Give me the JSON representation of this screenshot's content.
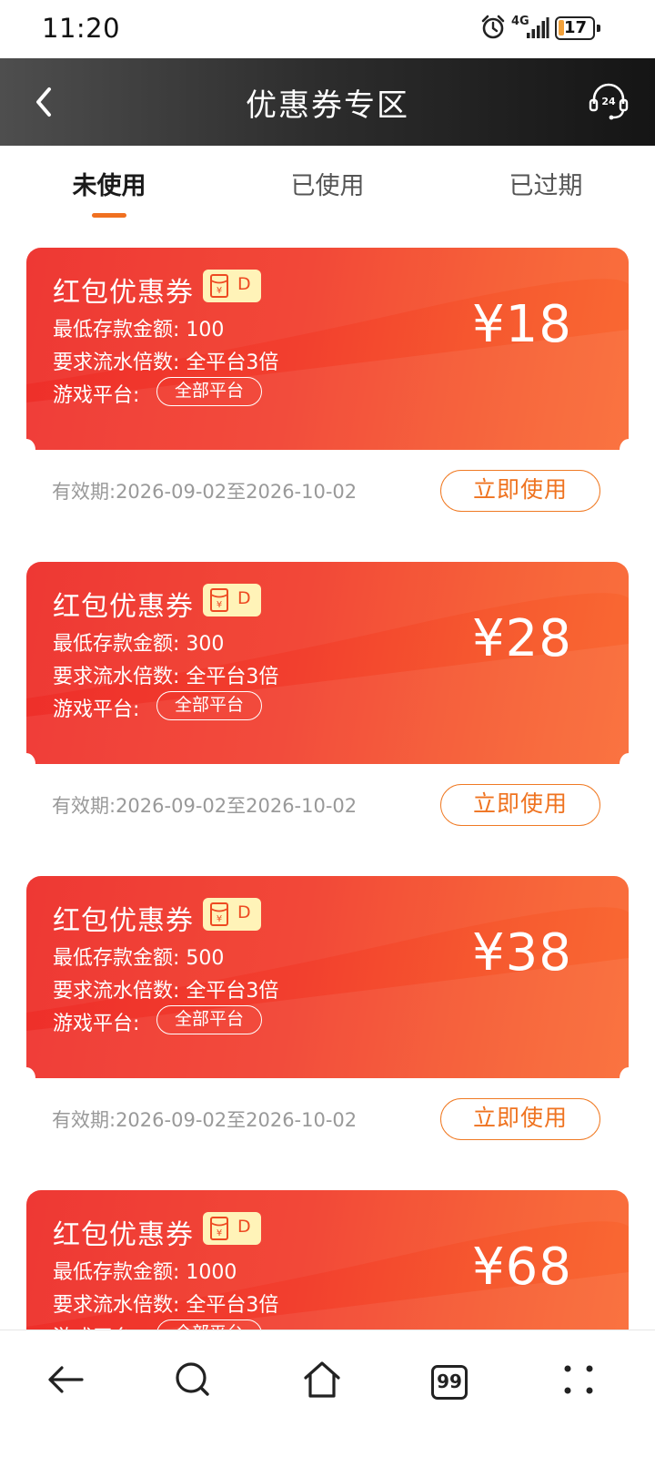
{
  "status_bar": {
    "time": "11:20",
    "network": "4G",
    "battery": "17",
    "battery_level": 0.17,
    "icons": [
      "alarm-icon",
      "signal-icon",
      "battery-icon"
    ]
  },
  "header": {
    "title": "优惠券专区",
    "back_icon": "chevron-left-icon",
    "support_icon": "support-24h-icon"
  },
  "tabs": [
    {
      "label": "未使用",
      "active": true
    },
    {
      "label": "已使用",
      "active": false
    },
    {
      "label": "已过期",
      "active": false
    }
  ],
  "colors": {
    "accent": "#F07020",
    "card_start": "#EE2E2A",
    "card_end": "#FA6A33",
    "badge_bg": "#FFF3B8"
  },
  "coupons": [
    {
      "name": "红包优惠券",
      "badge_letter": "D",
      "min_deposit": "最低存款金额: 100",
      "turnover": "要求流水倍数: 全平台3倍",
      "platform_label": "游戏平台:",
      "platform_tag": "全部平台",
      "amount": "¥18",
      "validity": "有效期:2026-09-02至2026-10-02",
      "button": "立即使用"
    },
    {
      "name": "红包优惠券",
      "badge_letter": "D",
      "min_deposit": "最低存款金额: 300",
      "turnover": "要求流水倍数: 全平台3倍",
      "platform_label": "游戏平台:",
      "platform_tag": "全部平台",
      "amount": "¥28",
      "validity": "有效期:2026-09-02至2026-10-02",
      "button": "立即使用"
    },
    {
      "name": "红包优惠券",
      "badge_letter": "D",
      "min_deposit": "最低存款金额: 500",
      "turnover": "要求流水倍数: 全平台3倍",
      "platform_label": "游戏平台:",
      "platform_tag": "全部平台",
      "amount": "¥38",
      "validity": "有效期:2026-09-02至2026-10-02",
      "button": "立即使用"
    },
    {
      "name": "红包优惠券",
      "badge_letter": "D",
      "min_deposit": "最低存款金额: 1000",
      "turnover": "要求流水倍数: 全平台3倍",
      "platform_label": "游戏平台:",
      "platform_tag": "全部平台",
      "amount": "¥68"
    }
  ],
  "bottom_nav": {
    "tabs_count": "99",
    "icons": [
      "back-arrow-icon",
      "search-icon",
      "home-icon",
      "tabs-icon",
      "more-icon"
    ]
  }
}
